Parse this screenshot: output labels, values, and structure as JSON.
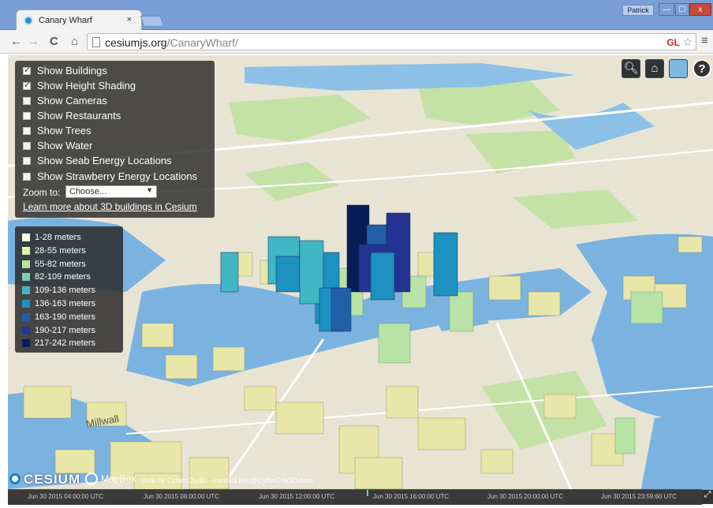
{
  "browser": {
    "tab_title": "Canary Wharf",
    "tab_close": "×",
    "user_label": "Patrick",
    "win_min": "—",
    "win_max": "☐",
    "win_close": "x",
    "url_host": "cesiumjs.org",
    "url_path": "/CanaryWharf/",
    "gl_badge": "GL"
  },
  "toggles": [
    {
      "label": "Show Buildings",
      "checked": true
    },
    {
      "label": "Show Height Shading",
      "checked": true
    },
    {
      "label": "Show Cameras",
      "checked": false
    },
    {
      "label": "Show Restaurants",
      "checked": false
    },
    {
      "label": "Show Trees",
      "checked": false
    },
    {
      "label": "Show Water",
      "checked": false
    },
    {
      "label": "Show Seab Energy Locations",
      "checked": false
    },
    {
      "label": "Show Strawberry Energy Locations",
      "checked": false
    }
  ],
  "zoom": {
    "label": "Zoom to:",
    "selected": "Choose..."
  },
  "learn_link": "Learn more about 3D buildings in Cesium",
  "legend": [
    {
      "label": "1-28 meters",
      "color": "#fffdd4"
    },
    {
      "label": "28-55 meters",
      "color": "#e3f2a8"
    },
    {
      "label": "55-82 meters",
      "color": "#b9e3a6"
    },
    {
      "label": "82-109 meters",
      "color": "#7dcdb2"
    },
    {
      "label": "109-136 meters",
      "color": "#41b6c4"
    },
    {
      "label": "136-163 meters",
      "color": "#1d91c0"
    },
    {
      "label": "163-190 meters",
      "color": "#225ea8"
    },
    {
      "label": "190-217 meters",
      "color": "#253494"
    },
    {
      "label": "217-242 meters",
      "color": "#081d58"
    }
  ],
  "map_buttons": {
    "help": "?"
  },
  "credits": {
    "cesium": "CESIUM",
    "mapbox": "MapBox",
    "text": "data by CyberCity3D - contact info@CyberCity3D.com"
  },
  "timeline_ticks": [
    "Jun 30 2015 04:00:00 UTC",
    "Jun 30 2015 08:00:00 UTC",
    "Jun 30 2015 12:00:00 UTC",
    "Jun 30 2015 16:00:00 UTC",
    "Jun 30 2015 20:00:00 UTC",
    "Jun 30 2015 23:59:60 UTC"
  ],
  "map_labels": [
    "Millwall"
  ],
  "colors": {
    "water": "#7ab3e0",
    "land": "#e8e4d4",
    "park": "#bfe0a0"
  }
}
